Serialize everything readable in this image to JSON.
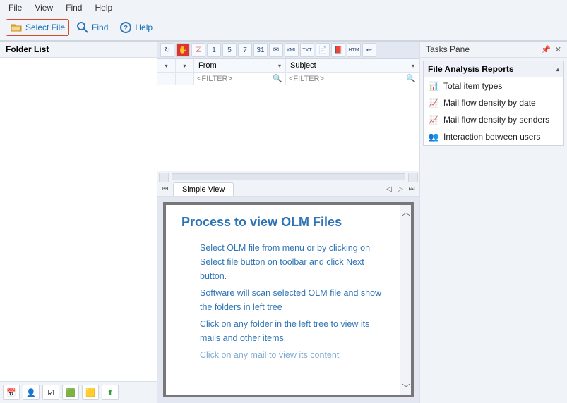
{
  "menu": {
    "file": "File",
    "view": "View",
    "find": "Find",
    "help": "Help"
  },
  "toolbar": {
    "select_file": "Select File",
    "find": "Find",
    "help": "Help"
  },
  "left": {
    "header": "Folder List"
  },
  "grid": {
    "col_from": "From",
    "col_subject": "Subject",
    "filter_placeholder": "<FILTER>"
  },
  "tabs": {
    "simple": "Simple View"
  },
  "preview": {
    "title": "Process to view OLM Files",
    "p1": "Select OLM file from menu or by clicking on Select file button on toolbar and click Next button.",
    "p2": "Software will scan selected OLM file and show the folders in left tree",
    "p3": "Click on any folder in the left tree to view its mails and other items.",
    "p4": "Click on any mail to view its content"
  },
  "tasks": {
    "pane_title": "Tasks Pane",
    "section": "File Analysis Reports",
    "r1": "Total item types",
    "r2": "Mail flow density by date",
    "r3": "Mail flow density by senders",
    "r4": "Interaction between users"
  }
}
